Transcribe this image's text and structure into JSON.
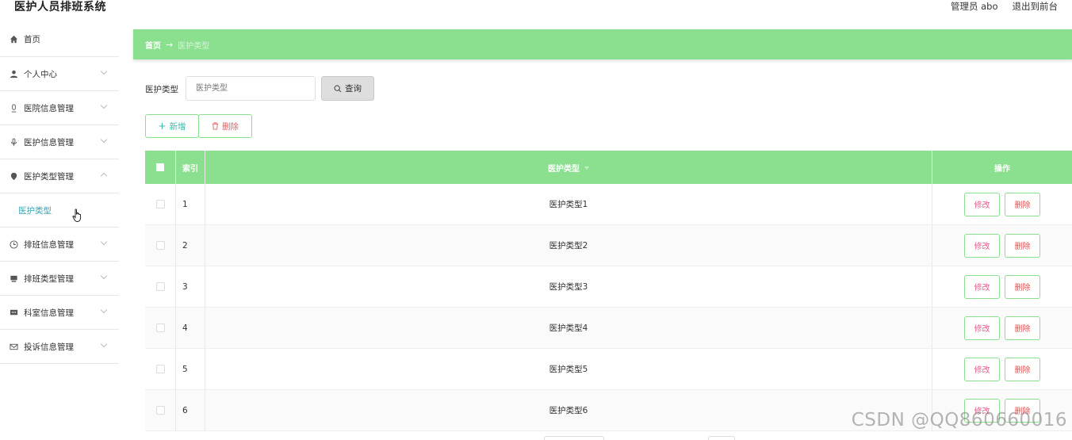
{
  "app_title": "医护人员排班系统",
  "header": {
    "user_label": "管理员 abo",
    "exit_label": "退出到前台"
  },
  "sidebar": {
    "items": [
      {
        "label": "首页",
        "icon": "home-icon"
      },
      {
        "label": "个人中心",
        "icon": "user-icon"
      },
      {
        "label": "医院信息管理",
        "icon": "microphone-icon"
      },
      {
        "label": "医护信息管理",
        "icon": "microphone-icon"
      },
      {
        "label": "医护类型管理",
        "icon": "location-icon"
      },
      {
        "label": "排班信息管理",
        "icon": "clock-icon"
      },
      {
        "label": "排班类型管理",
        "icon": "monitor-icon"
      },
      {
        "label": "科室信息管理",
        "icon": "chat-icon"
      },
      {
        "label": "投诉信息管理",
        "icon": "mail-icon"
      }
    ],
    "active_sub": "医护类型"
  },
  "breadcrumb": {
    "home": "首页",
    "arrow": "→",
    "current": "医护类型"
  },
  "search": {
    "label": "医护类型",
    "placeholder": "医护类型",
    "button_label": "查询"
  },
  "actions": {
    "add_label": "新增",
    "delete_label": "删除"
  },
  "table": {
    "columns": [
      "索引",
      "医护类型",
      "操作"
    ],
    "rows": [
      {
        "index": "1",
        "type": "医护类型1"
      },
      {
        "index": "2",
        "type": "医护类型2"
      },
      {
        "index": "3",
        "type": "医护类型3"
      },
      {
        "index": "4",
        "type": "医护类型4"
      },
      {
        "index": "5",
        "type": "医护类型5"
      },
      {
        "index": "6",
        "type": "医护类型6"
      }
    ],
    "edit_label": "修改",
    "delete_label": "删除"
  },
  "watermark": "CSDN @QQ860660016",
  "colors": {
    "accent_green": "#8ae08e",
    "active_text": "#39a5b8",
    "delete_red": "#e05555",
    "edit_pink": "#e0608e"
  }
}
